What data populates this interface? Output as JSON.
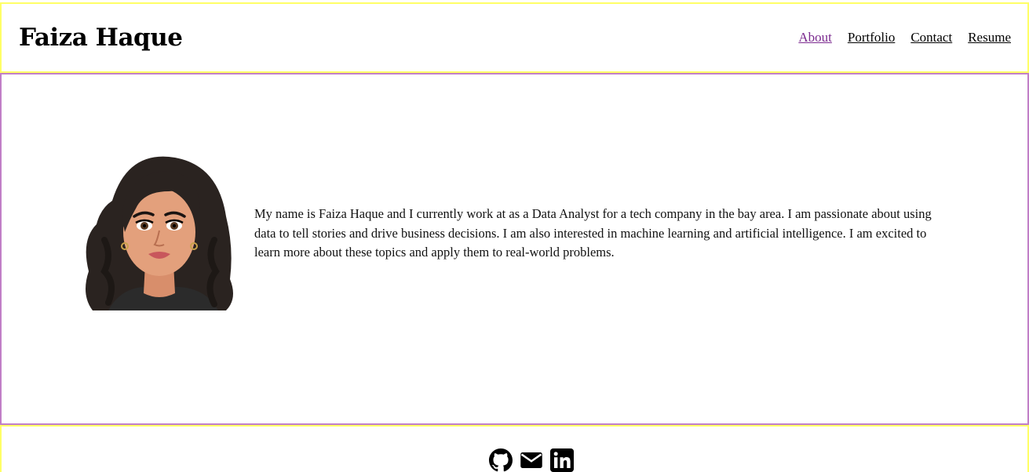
{
  "header": {
    "title": "Faiza Haque",
    "nav": [
      {
        "label": "About",
        "active": true
      },
      {
        "label": "Portfolio",
        "active": false
      },
      {
        "label": "Contact",
        "active": false
      },
      {
        "label": "Resume",
        "active": false
      }
    ]
  },
  "about": {
    "avatar_icon": "portrait-illustration",
    "text": "My name is Faiza Haque and I currently work at as a Data Analyst for a tech company in the bay area. I am passionate about using data to tell stories and drive business decisions. I am also interested in machine learning and artificial intelligence. I am excited to learn more about these topics and apply them to real-world problems."
  },
  "footer": {
    "social_icons": [
      "github-icon",
      "envelope-icon",
      "linkedin-icon"
    ]
  },
  "colors": {
    "header_border": "#ffff66",
    "main_border": "#c17fc7",
    "active_link": "#7b2a8f"
  }
}
